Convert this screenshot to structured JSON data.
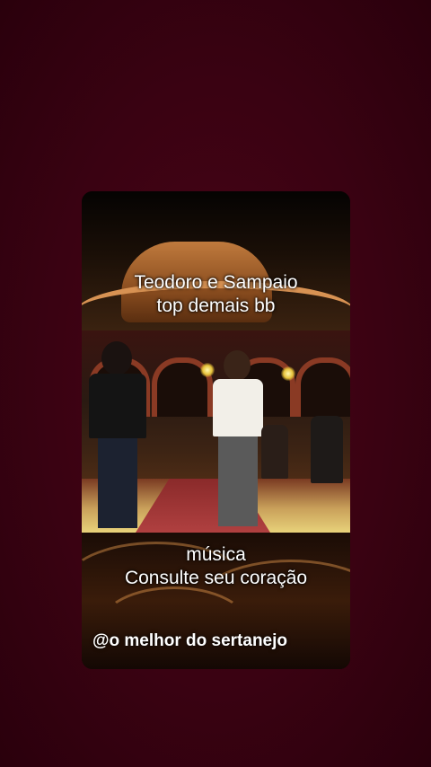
{
  "video": {
    "caption_top": {
      "line1": "Teodoro e Sampaio",
      "line2": "top demais bb"
    },
    "caption_bottom": {
      "line1": "música",
      "line2": "Consulte seu coração"
    },
    "watermark": "@o melhor do sertanejo"
  },
  "colors": {
    "background": "#3a0212",
    "caption_text": "#ffffff"
  }
}
